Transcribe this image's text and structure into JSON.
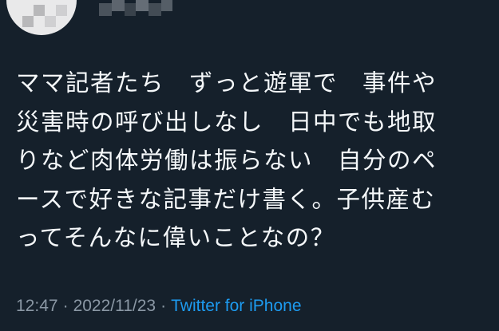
{
  "tweet": {
    "lines": [
      "ママ記者たち　ずっと遊軍で　事件や",
      "災害時の呼び出しなし　日中でも地取",
      "りなど肉体労働は振らない　自分のペ",
      "ースで好きな記事だけ書く。子供産む",
      "ってそんなに偉いことなの？"
    ],
    "time": "12:47",
    "date": "2022/11/23",
    "separator": "·",
    "source": "Twitter for iPhone"
  },
  "icons": {
    "avatar": "avatar-blurred",
    "name": "username-mosaic"
  },
  "colors": {
    "background": "#15202b",
    "text": "#f5f8fa",
    "meta": "#8b98a5",
    "link": "#1d9bf0"
  }
}
